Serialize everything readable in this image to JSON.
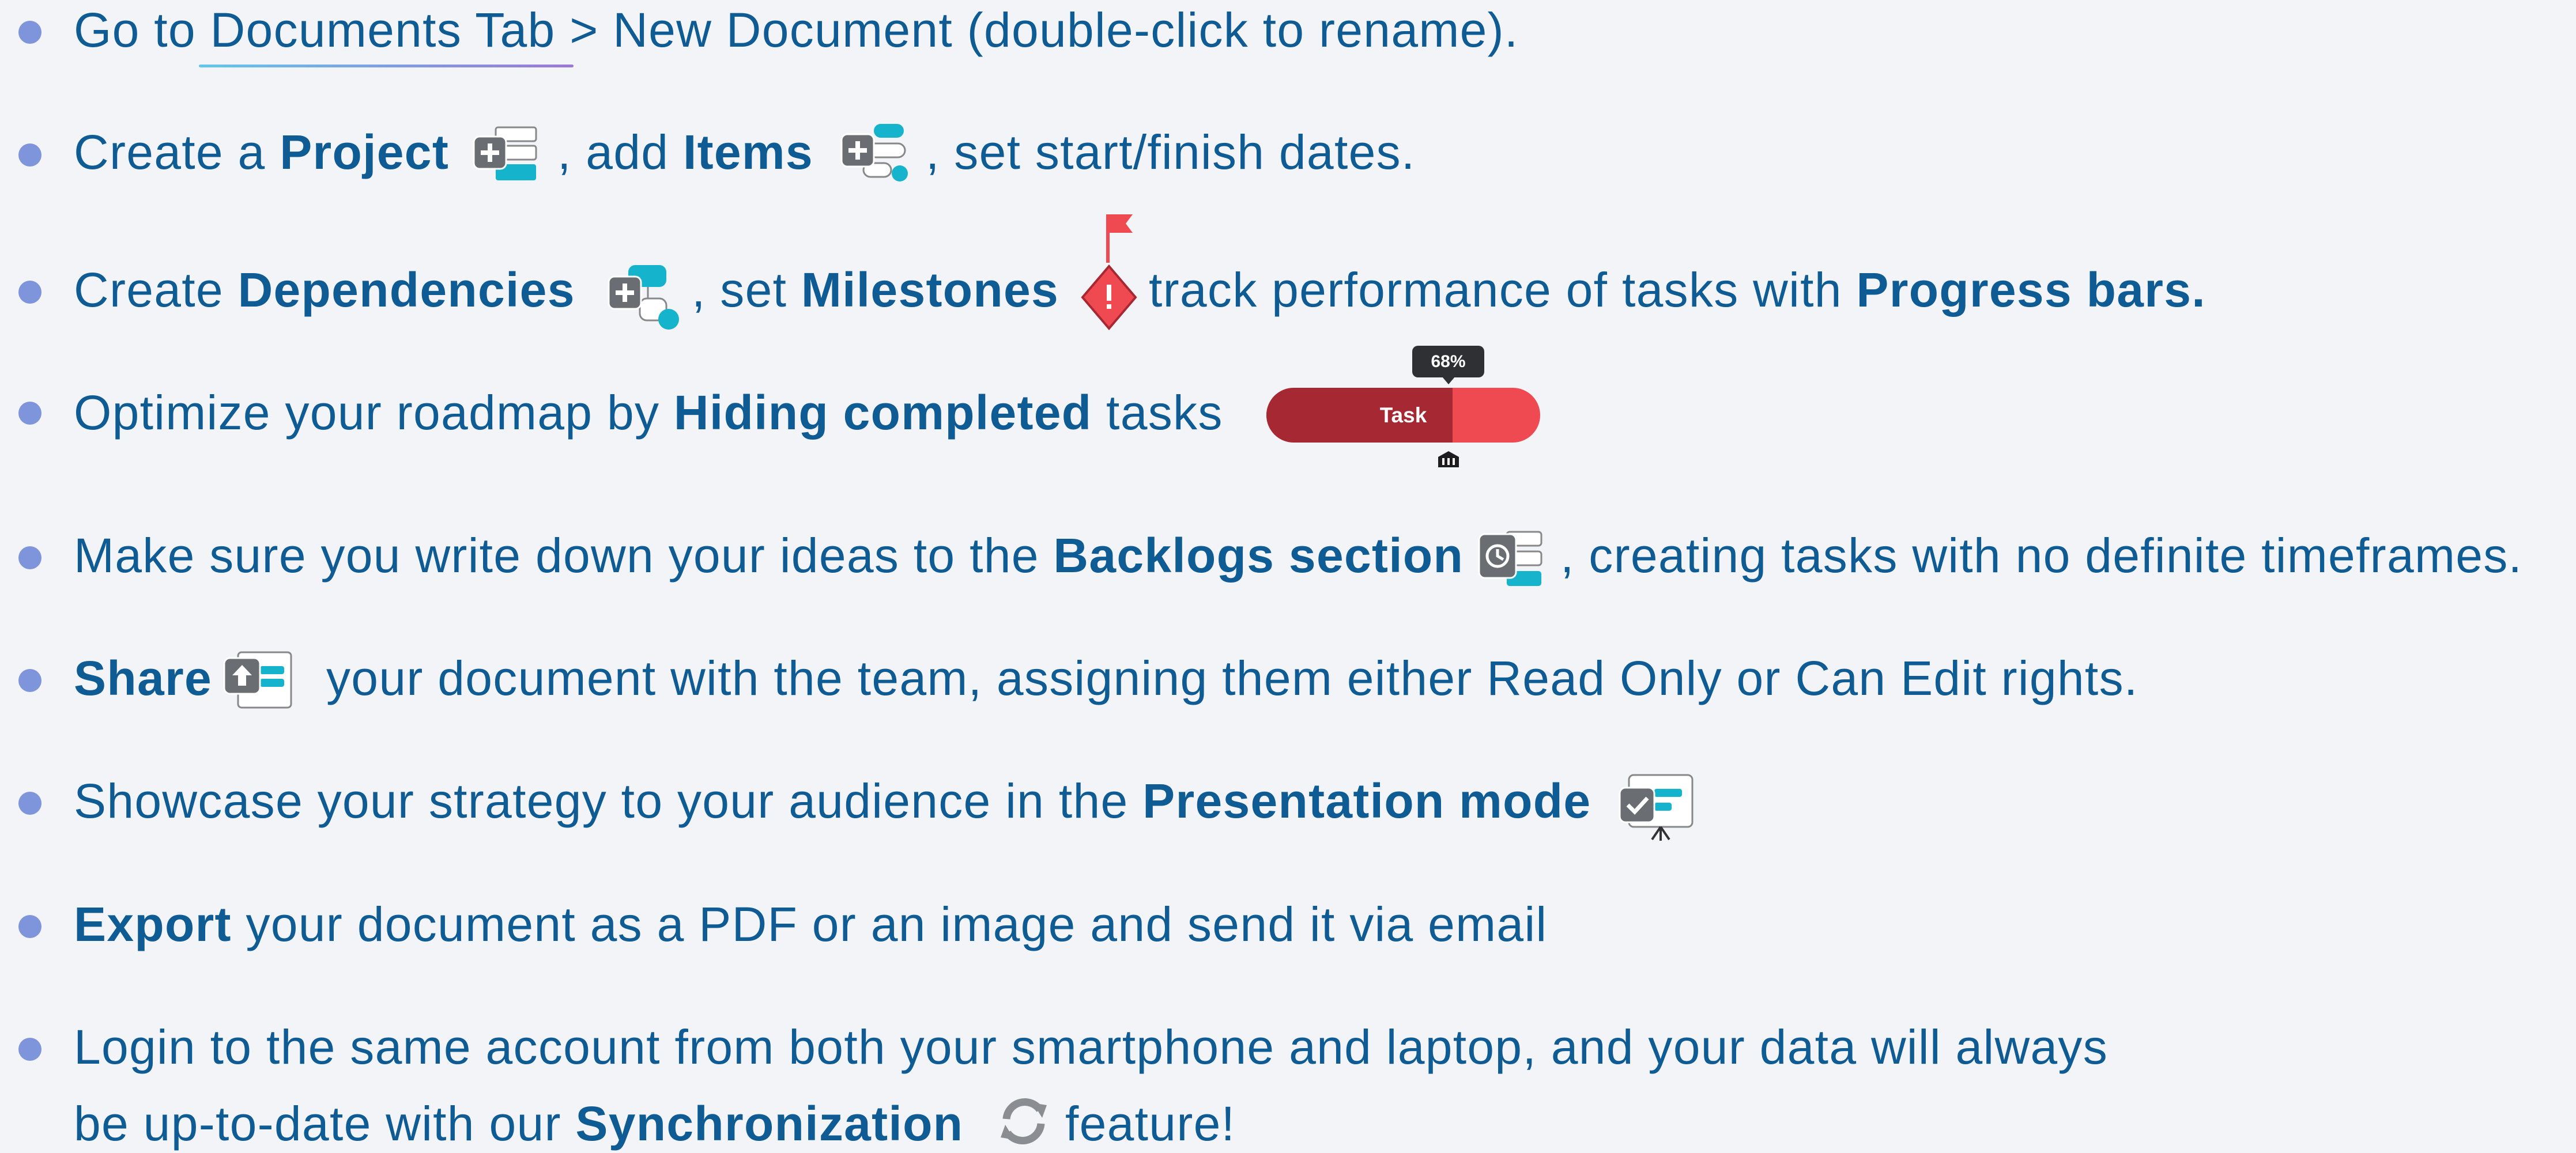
{
  "colors": {
    "text": "#0f5b93",
    "bullet": "#7e95dc",
    "accent_teal": "#16b4cc",
    "accent_red": "#ef4a52",
    "accent_dark_red": "#a62832",
    "icon_grey": "#6a6d72"
  },
  "items": [
    {
      "parts": [
        "Go to Documents Tab > New Document (double-click to rename)."
      ]
    },
    {
      "p1": "Create a ",
      "b1": "Project",
      "p2": ", add ",
      "b2": "Items",
      "p3": ", set start/finish dates.",
      "icons": [
        "add-project-icon",
        "add-items-icon"
      ]
    },
    {
      "p1": "Create ",
      "b1": "Dependencies",
      "p2": ", set ",
      "b2": "Milestones",
      "p3": "track performance of tasks with ",
      "b3": "Progress bars.",
      "icons": [
        "add-dependency-icon",
        "milestone-diamond-icon"
      ]
    },
    {
      "p1": "Optimize your roadmap by ",
      "b1": "Hiding completed",
      "p2": " tasks",
      "task_bar": {
        "tooltip": "68%",
        "label": "Task",
        "progress_percent": 68
      }
    },
    {
      "p1": "Make sure you write down your ideas to the ",
      "b1": "Backlogs section",
      "p2": ", creating tasks with no definite timeframes.",
      "icons": [
        "backlog-icon"
      ]
    },
    {
      "b1": "Share",
      "p1": "your document with the team, assigning them either Read Only or Can Edit rights.",
      "icons": [
        "share-document-icon"
      ]
    },
    {
      "p1": "Showcase your strategy to your audience in the ",
      "b1": "Presentation mode",
      "icons": [
        "presentation-icon"
      ]
    },
    {
      "b1": "Export",
      "p1": " your document as a PDF or an image and send it via email"
    },
    {
      "p1": "Login to the same account from both your smartphone and laptop, and your data will always",
      "p2": "be up-to-date with our ",
      "b1": "Synchronization",
      "p3": "feature!",
      "icons": [
        "sync-icon"
      ]
    }
  ]
}
